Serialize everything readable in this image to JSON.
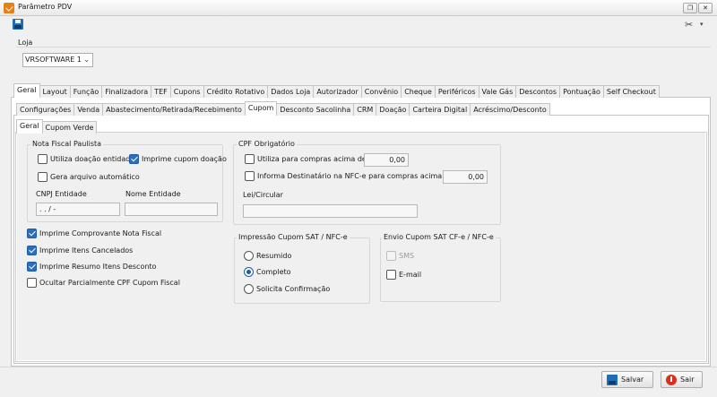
{
  "window": {
    "title": "Parâmetro PDV",
    "restore_glyph": "❐",
    "close_glyph": "✕"
  },
  "toolbar": {
    "save_icon": "floppy-disk-icon",
    "tools_icon": "tools-icon",
    "tools_glyph": "✂",
    "caret_glyph": "▾"
  },
  "loja": {
    "label": "Loja",
    "selected": "VRSOFTWARE 1",
    "caret_glyph": "⌄"
  },
  "tabs_level1": [
    {
      "label": "Geral",
      "active": true
    },
    {
      "label": "Layout"
    },
    {
      "label": "Função"
    },
    {
      "label": "Finalizadora"
    },
    {
      "label": "TEF"
    },
    {
      "label": "Cupons"
    },
    {
      "label": "Crédito Rotativo"
    },
    {
      "label": "Dados Loja"
    },
    {
      "label": "Autorizador"
    },
    {
      "label": "Convênio"
    },
    {
      "label": "Cheque"
    },
    {
      "label": "Periféricos"
    },
    {
      "label": "Vale Gás"
    },
    {
      "label": "Descontos"
    },
    {
      "label": "Pontuação"
    },
    {
      "label": "Self Checkout"
    }
  ],
  "tabs_level2": [
    {
      "label": "Configurações"
    },
    {
      "label": "Venda"
    },
    {
      "label": "Abastecimento/Retirada/Recebimento"
    },
    {
      "label": "Cupom",
      "active": true
    },
    {
      "label": "Desconto Sacolinha"
    },
    {
      "label": "CRM"
    },
    {
      "label": "Doação"
    },
    {
      "label": "Carteira Digital"
    },
    {
      "label": "Acréscimo/Desconto"
    }
  ],
  "tabs_level3": [
    {
      "label": "Geral",
      "active": true
    },
    {
      "label": "Cupom Verde"
    }
  ],
  "nota_fiscal_paulista": {
    "title": "Nota Fiscal Paulista",
    "utiliza_doacao": "Utiliza doação entidade",
    "imprime_cupom_doacao": "Imprime cupom doação",
    "gera_arquivo": "Gera arquivo automático",
    "cnpj_label": "CNPJ Entidade",
    "cnpj_value": " .  .  /  -",
    "nome_label": "Nome Entidade",
    "nome_value": ""
  },
  "cpf_obrigatorio": {
    "title": "CPF Obrigatório",
    "utiliza_compras": "Utiliza para compras acima de R$",
    "utiliza_value": "0,00",
    "informa_destinatario": "Informa Destinatário na NFC-e para compras acima de R$",
    "informa_value": "0,00",
    "lei_label": "Lei/Circular",
    "lei_value": ""
  },
  "options": {
    "imprime_comprovante": "Imprime Comprovante Nota Fiscal",
    "imprime_itens_cancelados": "Imprime Itens Cancelados",
    "imprime_resumo": "Imprime Resumo Itens Desconto",
    "ocultar_cpf": "Ocultar Parcialmente CPF Cupom Fiscal"
  },
  "impressao": {
    "title": "Impressão Cupom SAT / NFC-e",
    "resumido": "Resumido",
    "completo": "Completo",
    "solicita": "Solicita Confirmação"
  },
  "envio": {
    "title": "Envio Cupom SAT CF-e / NFC-e",
    "sms": "SMS",
    "email": "E-mail"
  },
  "buttons": {
    "save": "Salvar",
    "exit": "Sair"
  }
}
